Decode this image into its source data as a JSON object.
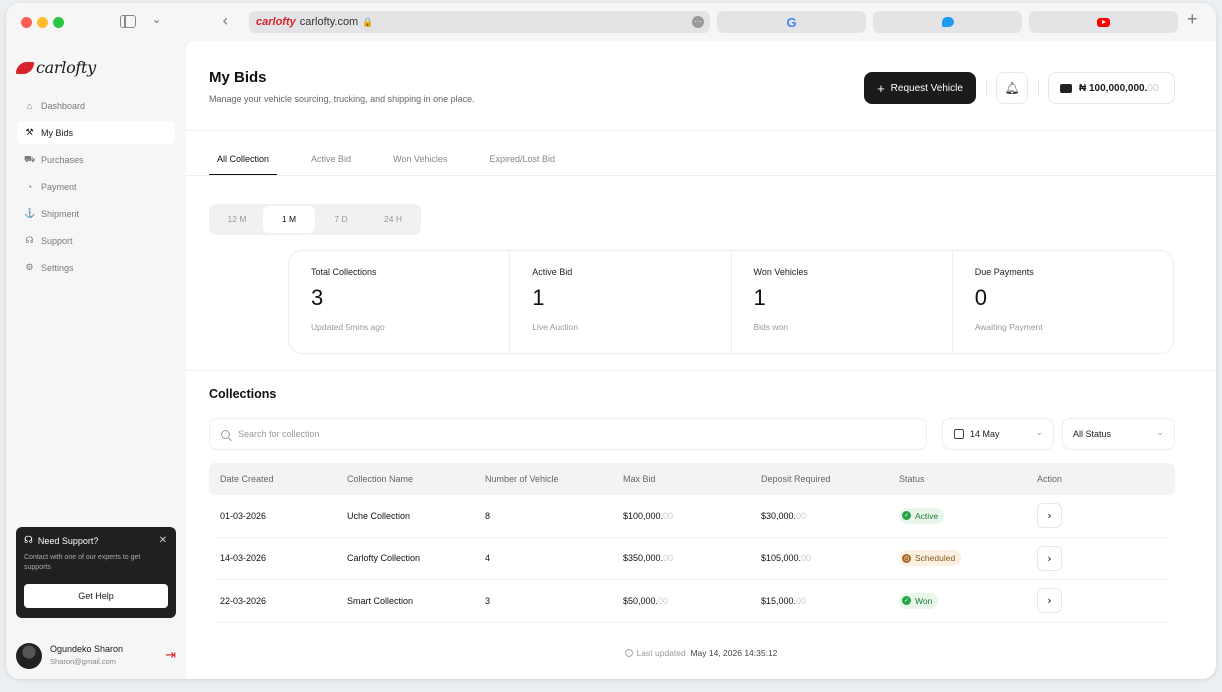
{
  "browser": {
    "url_brand": "carlofty",
    "url": "carlofty.com",
    "tabs": [
      "google-icon",
      "twitter-icon",
      "youtube-icon"
    ]
  },
  "brand": {
    "name": "carlofty",
    "accent": "#d9232a"
  },
  "sidebar": {
    "items": [
      {
        "label": "Dashboard",
        "icon": "home-icon"
      },
      {
        "label": "My Bids",
        "icon": "gavel-icon",
        "active": true
      },
      {
        "label": "Purchases",
        "icon": "car-icon"
      },
      {
        "label": "Payment",
        "icon": "wallet-icon"
      },
      {
        "label": "Shipment",
        "icon": "ship-icon"
      },
      {
        "label": "Support",
        "icon": "headset-icon"
      },
      {
        "label": "Settings",
        "icon": "gear-icon"
      }
    ],
    "support": {
      "title": "Need Support?",
      "desc": "Contact with one of our experts to get supports",
      "button": "Get Help"
    },
    "user": {
      "name": "Ogundeko Sharon",
      "email": "Sharon@gmail.com"
    }
  },
  "header": {
    "title": "My Bids",
    "subtitle": "Manage your vehicle sourcing, trucking, and shipping in one place.",
    "request_button": "Request Vehicle",
    "wallet_main": "₦ 100,000,000.",
    "wallet_fade": "00"
  },
  "tabs": [
    "All Collection",
    "Active Bid",
    "Won Vehicles",
    "Expired/Lost Bid"
  ],
  "periods": [
    "12 M",
    "1 M",
    "7 D",
    "24 H"
  ],
  "stats": [
    {
      "label": "Total Collections",
      "value": "3",
      "note": "Updated 5mins ago"
    },
    {
      "label": "Active Bid",
      "value": "1",
      "note": "Live Auction"
    },
    {
      "label": "Won Vehicles",
      "value": "1",
      "note": "Bids won"
    },
    {
      "label": "Due Payments",
      "value": "0",
      "note": "Awaiting Payment"
    }
  ],
  "collections": {
    "title": "Collections",
    "search_placeholder": "Search for collection",
    "date_filter": "14 May",
    "status_filter": "All Status",
    "columns": [
      "Date Created",
      "Collection Name",
      "Number of Vehicle",
      "Max Bid",
      "Deposit Required",
      "Status",
      "Action"
    ],
    "rows": [
      {
        "date": "01-03-2026",
        "name": "Uche Collection",
        "count": "8",
        "max_bid": "$100,000.",
        "max_bid_fade": "00",
        "deposit": "$30,000.",
        "deposit_fade": "00",
        "status": "Active",
        "status_color": "#27a348"
      },
      {
        "date": "14-03-2026",
        "name": "Carlofty Collection",
        "count": "4",
        "max_bid": "$350,000.",
        "max_bid_fade": "00",
        "deposit": "$105,000.",
        "deposit_fade": "00",
        "status": "Scheduled",
        "status_color": "#a86a24"
      },
      {
        "date": "22-03-2026",
        "name": "Smart Collection",
        "count": "3",
        "max_bid": "$50,000.",
        "max_bid_fade": "00",
        "deposit": "$15,000.",
        "deposit_fade": "00",
        "status": "Won",
        "status_color": "#27a348"
      }
    ]
  },
  "footer": {
    "label": "Last updated",
    "timestamp": "May 14, 2026 14:35:12"
  }
}
